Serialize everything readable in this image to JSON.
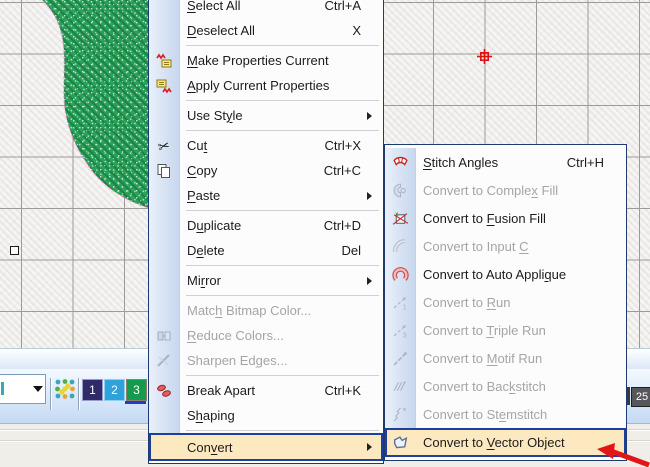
{
  "colors": {
    "menu_highlight_bg": "#fde9c0",
    "menu_highlight_border": "#1d3f9e",
    "menu_border": "#1f3a6e",
    "disabled_text": "#a5a5a5",
    "grid_line": "#9b9b9b",
    "shape_green": "#2aa159",
    "marker_red": "#dd1111",
    "selection_underline_blue": "#2437cf",
    "annotation_arrow_red": "#e41515",
    "chip1_color": "#312a68",
    "chip2_color": "#2ea3d9",
    "chip3_color": "#169a4e"
  },
  "canvas": {
    "object": "green-satin-fill-embroidery-shape",
    "origin_marker": "red-crosshair",
    "selection_handle": "small-square-handle"
  },
  "context_menu": {
    "items": [
      {
        "pre": "",
        "key": "S",
        "post": "elect All",
        "shortcut": "Ctrl+A",
        "state": "enabled"
      },
      {
        "pre": "",
        "key": "D",
        "post": "eselect All",
        "shortcut": "X",
        "state": "enabled"
      },
      {
        "pre": "",
        "key": "M",
        "post": "ake Properties Current",
        "shortcut": "",
        "state": "enabled",
        "icon": "make-properties-current-icon"
      },
      {
        "pre": "",
        "key": "A",
        "post": "pply Current Properties",
        "shortcut": "",
        "state": "enabled",
        "icon": "apply-current-properties-icon"
      },
      {
        "pre": "Use St",
        "key": "y",
        "post": "le",
        "shortcut": "",
        "state": "enabled",
        "has_submenu": true
      },
      {
        "pre": "Cu",
        "key": "t",
        "post": "",
        "shortcut": "Ctrl+X",
        "state": "enabled",
        "icon": "scissors-icon"
      },
      {
        "pre": "",
        "key": "C",
        "post": "opy",
        "shortcut": "Ctrl+C",
        "state": "enabled",
        "icon": "copy-icon"
      },
      {
        "pre": "",
        "key": "P",
        "post": "aste",
        "shortcut": "",
        "state": "enabled",
        "has_submenu": true
      },
      {
        "pre": "D",
        "key": "u",
        "post": "plicate",
        "shortcut": "Ctrl+D",
        "state": "enabled"
      },
      {
        "pre": "D",
        "key": "e",
        "post": "lete",
        "shortcut": "Del",
        "state": "enabled"
      },
      {
        "pre": "Mi",
        "key": "r",
        "post": "ror",
        "shortcut": "",
        "state": "enabled",
        "has_submenu": true
      },
      {
        "pre": "Matc",
        "key": "h",
        "post": " Bitmap Color...",
        "shortcut": "",
        "state": "disabled"
      },
      {
        "pre": "",
        "key": "R",
        "post": "educe Colors...",
        "shortcut": "",
        "state": "disabled",
        "icon": "reduce-colors-icon"
      },
      {
        "pre": "Sharpen Ed",
        "key": "g",
        "post": "es...",
        "shortcut": "",
        "state": "disabled",
        "icon": "sharpen-edges-icon"
      },
      {
        "pre": "Break Apart",
        "key": "",
        "post": "",
        "shortcut": "Ctrl+K",
        "state": "enabled",
        "icon": "break-apart-icon"
      },
      {
        "pre": "S",
        "key": "h",
        "post": "aping",
        "shortcut": "",
        "state": "enabled",
        "has_submenu": true
      },
      {
        "pre": "Con",
        "key": "v",
        "post": "ert",
        "shortcut": "",
        "state": "enabled",
        "has_submenu": true,
        "highlighted": true
      }
    ]
  },
  "convert_submenu": {
    "items": [
      {
        "pre": "",
        "key": "S",
        "post": "titch Angles",
        "shortcut": "Ctrl+H",
        "state": "enabled",
        "icon": "stitch-angles-icon"
      },
      {
        "pre": "Convert to Comple",
        "key": "x",
        "post": " Fill",
        "shortcut": "",
        "state": "disabled",
        "icon": "complex-fill-icon"
      },
      {
        "pre": "Convert to ",
        "key": "F",
        "post": "usion Fill",
        "shortcut": "",
        "state": "enabled",
        "icon": "fusion-fill-icon"
      },
      {
        "pre": "Convert to Input ",
        "key": "C",
        "post": "",
        "shortcut": "",
        "state": "disabled",
        "icon": "input-c-icon"
      },
      {
        "pre": "Convert to Auto Appli",
        "key": "q",
        "post": "ue",
        "shortcut": "",
        "state": "enabled",
        "icon": "auto-applique-icon"
      },
      {
        "pre": "Convert to ",
        "key": "R",
        "post": "un",
        "shortcut": "",
        "state": "disabled",
        "icon": "run-icon"
      },
      {
        "pre": "Convert to ",
        "key": "T",
        "post": "riple Run",
        "shortcut": "",
        "state": "disabled",
        "icon": "triple-run-icon"
      },
      {
        "pre": "Convert to ",
        "key": "M",
        "post": "otif Run",
        "shortcut": "",
        "state": "disabled",
        "icon": "motif-run-icon"
      },
      {
        "pre": "Convert to Bac",
        "key": "k",
        "post": "stitch",
        "shortcut": "",
        "state": "disabled",
        "icon": "backstitch-icon"
      },
      {
        "pre": "Convert to St",
        "key": "e",
        "post": "mstitch",
        "shortcut": "",
        "state": "disabled",
        "icon": "stemstitch-icon"
      },
      {
        "pre": "Convert to ",
        "key": "V",
        "post": "ector Object",
        "shortcut": "",
        "state": "enabled",
        "icon": "vector-object-icon",
        "highlighted": true
      }
    ]
  },
  "bottom_toolbar": {
    "combobox_value": "",
    "palette_chips": [
      {
        "number": "1"
      },
      {
        "number": "2"
      },
      {
        "number": "3"
      }
    ],
    "selected_chip": "3",
    "right_chip_number": "25"
  },
  "annotation": {
    "type": "red-arrow",
    "points_to": "Convert to Vector Object"
  }
}
